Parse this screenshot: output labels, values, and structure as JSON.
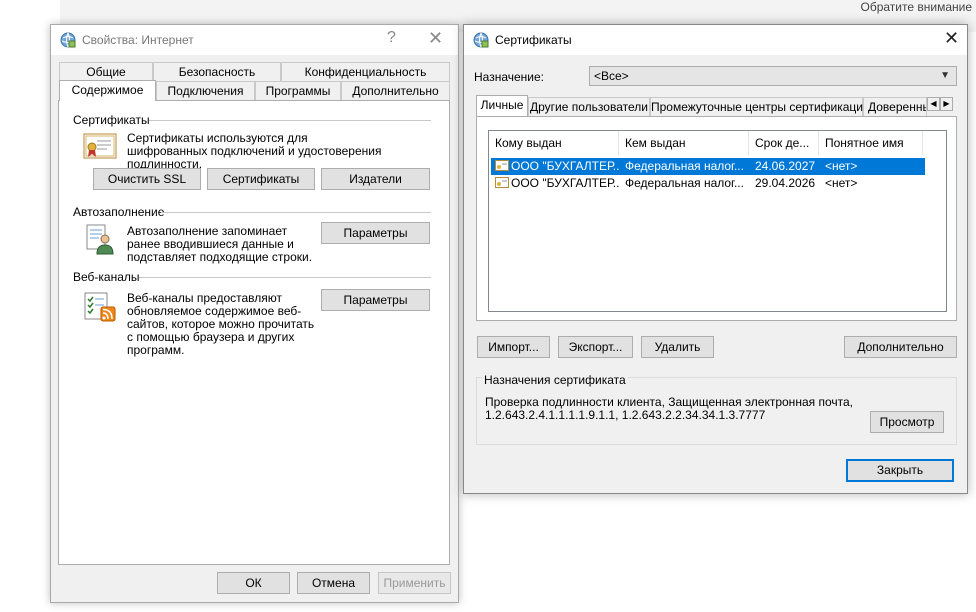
{
  "background": {
    "top_right_text": "Обратите внимание"
  },
  "inet_options": {
    "title": "Свойства: Интернет",
    "help_glyph": "?",
    "tabs_row1": [
      "Общие",
      "Безопасность",
      "Конфиденциальность"
    ],
    "tabs_row2": [
      "Содержимое",
      "Подключения",
      "Программы",
      "Дополнительно"
    ],
    "active_tab": "Содержимое",
    "certificates": {
      "heading": "Сертификаты",
      "description": "Сертификаты используются для шифрованных подключений и удостоверения подлинности.",
      "clear_ssl": "Очистить SSL",
      "certificates_btn": "Сертификаты",
      "publishers_btn": "Издатели"
    },
    "autocomplete": {
      "heading": "Автозаполнение",
      "description": "Автозаполнение запоминает ранее вводившиеся данные и подставляет подходящие строки.",
      "params_btn": "Параметры"
    },
    "feeds": {
      "heading": "Веб-каналы",
      "description": "Веб-каналы предоставляют обновляемое содержимое веб-сайтов, которое можно прочитать с помощью браузера и других программ.",
      "params_btn": "Параметры"
    },
    "ok": "ОК",
    "cancel": "Отмена",
    "apply": "Применить"
  },
  "certs_dialog": {
    "title": "Сертификаты",
    "purpose_label": "Назначение:",
    "purpose_value": "<Все>",
    "tabs": [
      "Личные",
      "Другие пользователи",
      "Промежуточные центры сертификации",
      "Доверенны"
    ],
    "active_tab": "Личные",
    "columns": [
      "Кому выдан",
      "Кем выдан",
      "Срок де...",
      "Понятное имя"
    ],
    "rows": [
      [
        "ООО \"БУХГАЛТЕР...",
        "Федеральная налог...",
        "24.06.2027",
        "<нет>"
      ],
      [
        "ООО \"БУХГАЛТЕР...",
        "Федеральная налог...",
        "29.04.2026",
        "<нет>"
      ]
    ],
    "selected_row": 0,
    "import_btn": "Импорт...",
    "export_btn": "Экспорт...",
    "remove_btn": "Удалить",
    "advanced_btn": "Дополнительно",
    "purposes_heading": "Назначения сертификата",
    "purposes_text_line1": "Проверка подлинности клиента, Защищенная электронная почта,",
    "purposes_text_line2": "1.2.643.2.4.1.1.1.1.9.1.1, 1.2.643.2.2.34.34.1.3.7777",
    "view_btn": "Просмотр",
    "close_btn": "Закрыть"
  },
  "colors": {
    "selection": "#0078d7",
    "dialog_bg": "#f0f0f0",
    "button_bg": "#e1e1e1"
  }
}
